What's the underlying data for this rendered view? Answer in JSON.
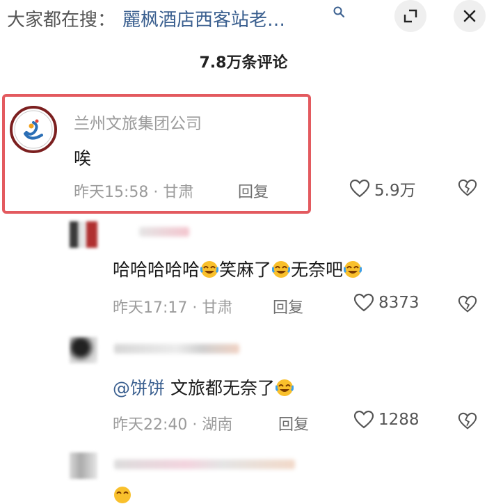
{
  "search": {
    "prefix": "大家都在搜：",
    "query": "麗枫酒店西客站老…"
  },
  "comment_count": "7.8万条评论",
  "comments": [
    {
      "username": "兰州文旅集团公司",
      "text": "唉",
      "time": "昨天15:58",
      "location": "甘肃",
      "reply": "回复",
      "likes": "5.9万"
    }
  ],
  "replies": [
    {
      "text_parts": [
        "哈哈哈哈哈",
        "笑麻了",
        "无奈吧"
      ],
      "time": "昨天17:17",
      "location": "甘肃",
      "reply": "回复",
      "likes": "8373"
    },
    {
      "mention": "@饼饼",
      "text": "文旅都无奈了",
      "time": "昨天22:40",
      "location": "湖南",
      "reply": "回复",
      "likes": "1288"
    }
  ],
  "separator": "·",
  "colors": {
    "highlight": "#e35a5f",
    "link": "#3a5f8f",
    "meta": "#9b9b9b"
  },
  "icons": [
    "search-icon",
    "resize-icon",
    "close-icon",
    "heart-icon",
    "broken-heart-icon",
    "laughing-crying-emoji"
  ]
}
